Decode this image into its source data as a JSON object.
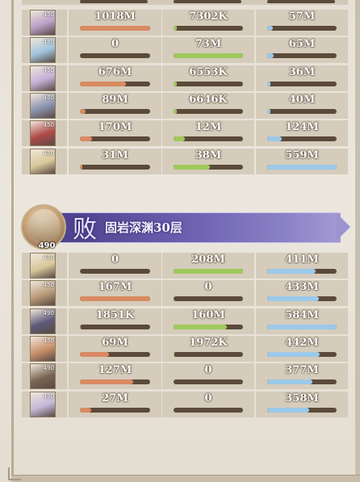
{
  "colors": {
    "orange": "#d98a62",
    "green": "#9ec95a",
    "blue": "#9cc9ea",
    "track": "#5b4a3a"
  },
  "groups": [
    {
      "rows": [
        {
          "avatar": {
            "icon": "character-portrait-icon",
            "level": "450",
            "tint": "#b8a0c8"
          },
          "c1": {
            "value": "1018M",
            "fill": 1.0,
            "color": "orange"
          },
          "c2": {
            "value": "7302K",
            "fill": 0.05,
            "color": "green"
          },
          "c3": {
            "value": "57M",
            "fill": 0.08,
            "color": "blue"
          }
        },
        {
          "avatar": {
            "icon": "character-portrait-icon",
            "level": "450",
            "tint": "#9fc4de"
          },
          "c1": {
            "value": "0",
            "fill": 0.0,
            "color": "orange"
          },
          "c2": {
            "value": "73M",
            "fill": 1.0,
            "color": "green"
          },
          "c3": {
            "value": "65M",
            "fill": 0.09,
            "color": "blue"
          }
        },
        {
          "avatar": {
            "icon": "character-portrait-icon",
            "level": "450",
            "tint": "#c4b0d8"
          },
          "c1": {
            "value": "676M",
            "fill": 0.66,
            "color": "orange"
          },
          "c2": {
            "value": "6553K",
            "fill": 0.05,
            "color": "green"
          },
          "c3": {
            "value": "36M",
            "fill": 0.05,
            "color": "blue"
          }
        },
        {
          "avatar": {
            "icon": "character-portrait-icon",
            "level": "450",
            "tint": "#8a92b0"
          },
          "c1": {
            "value": "89M",
            "fill": 0.08,
            "color": "orange"
          },
          "c2": {
            "value": "6646K",
            "fill": 0.05,
            "color": "green"
          },
          "c3": {
            "value": "40M",
            "fill": 0.05,
            "color": "blue"
          }
        },
        {
          "avatar": {
            "icon": "character-portrait-icon",
            "level": "450",
            "tint": "#b04a48"
          },
          "c1": {
            "value": "170M",
            "fill": 0.17,
            "color": "orange"
          },
          "c2": {
            "value": "12M",
            "fill": 0.16,
            "color": "green"
          },
          "c3": {
            "value": "124M",
            "fill": 0.21,
            "color": "blue"
          }
        },
        {
          "avatar": {
            "icon": "character-portrait-icon",
            "level": "450",
            "tint": "#d8c89a"
          },
          "c1": {
            "value": "31M",
            "fill": 0.03,
            "color": "orange"
          },
          "c2": {
            "value": "38M",
            "fill": 0.52,
            "color": "green"
          },
          "c3": {
            "value": "559M",
            "fill": 1.0,
            "color": "blue"
          }
        }
      ]
    },
    {
      "header": {
        "result": "败",
        "stage": "固岩深渊30层",
        "boss_level": "490",
        "boss_icon": "boss-portrait-icon"
      },
      "rows": [
        {
          "avatar": {
            "icon": "character-portrait-icon",
            "level": "450",
            "tint": "#d8c89a"
          },
          "c1": {
            "value": "0",
            "fill": 0.0,
            "color": "orange"
          },
          "c2": {
            "value": "208M",
            "fill": 1.0,
            "color": "green"
          },
          "c3": {
            "value": "411M",
            "fill": 0.7,
            "color": "blue"
          }
        },
        {
          "avatar": {
            "icon": "character-portrait-icon",
            "level": "450",
            "tint": "#b89a78"
          },
          "c1": {
            "value": "167M",
            "fill": 1.0,
            "color": "orange"
          },
          "c2": {
            "value": "0",
            "fill": 0.0,
            "color": "green"
          },
          "c3": {
            "value": "433M",
            "fill": 0.74,
            "color": "blue"
          }
        },
        {
          "avatar": {
            "icon": "character-portrait-icon",
            "level": "490",
            "tint": "#5e5a7a"
          },
          "c1": {
            "value": "1851K",
            "fill": 0.01,
            "color": "orange"
          },
          "c2": {
            "value": "160M",
            "fill": 0.77,
            "color": "green"
          },
          "c3": {
            "value": "584M",
            "fill": 1.0,
            "color": "blue"
          }
        },
        {
          "avatar": {
            "icon": "character-portrait-icon",
            "level": "450",
            "tint": "#c8906a"
          },
          "c1": {
            "value": "69M",
            "fill": 0.41,
            "color": "orange"
          },
          "c2": {
            "value": "1972K",
            "fill": 0.01,
            "color": "green"
          },
          "c3": {
            "value": "442M",
            "fill": 0.76,
            "color": "blue"
          }
        },
        {
          "avatar": {
            "icon": "character-portrait-icon",
            "level": "490",
            "tint": "#7a6654"
          },
          "c1": {
            "value": "127M",
            "fill": 0.76,
            "color": "orange"
          },
          "c2": {
            "value": "0",
            "fill": 0.0,
            "color": "green"
          },
          "c3": {
            "value": "377M",
            "fill": 0.65,
            "color": "blue"
          }
        },
        {
          "avatar": {
            "icon": "character-portrait-icon",
            "level": "490",
            "tint": "#c2b8d8"
          },
          "c1": {
            "value": "27M",
            "fill": 0.16,
            "color": "orange"
          },
          "c2": {
            "value": "0",
            "fill": 0.0,
            "color": "green"
          },
          "c3": {
            "value": "358M",
            "fill": 0.61,
            "color": "blue"
          }
        }
      ]
    }
  ]
}
